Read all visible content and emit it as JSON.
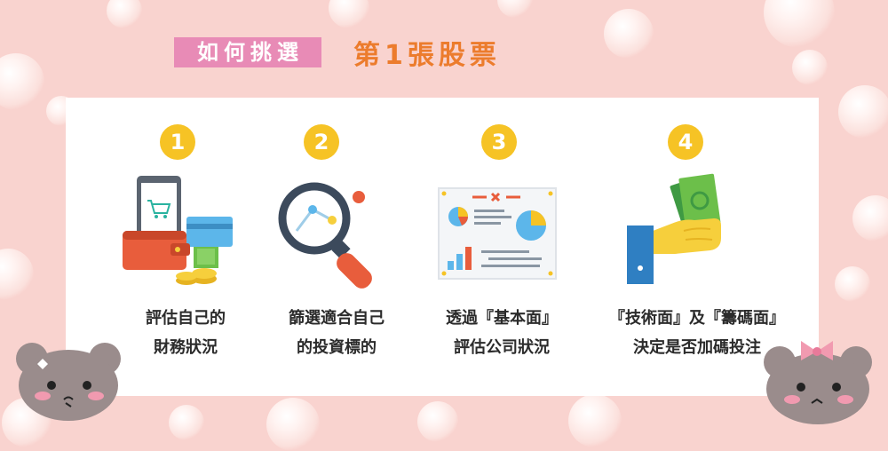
{
  "header": {
    "tag_label": "如何挑選",
    "main_title": "第1張股票"
  },
  "steps": [
    {
      "number": "1",
      "line1": "評估自己的",
      "line2": "財務狀況",
      "icon": "wallet-phone-icon"
    },
    {
      "number": "2",
      "line1": "篩選適合自己",
      "line2": "的投資標的",
      "icon": "magnifier-icon"
    },
    {
      "number": "3",
      "line1": "透過『基本面』",
      "line2": "評估公司狀況",
      "icon": "report-board-icon"
    },
    {
      "number": "4",
      "line1": "『技術面』及『籌碼面』",
      "line2": "決定是否加碼投注",
      "icon": "hand-money-icon"
    }
  ],
  "colors": {
    "background": "#f9d3cf",
    "tag": "#e88bb6",
    "title": "#ec7c2d",
    "badge": "#f6c325"
  }
}
